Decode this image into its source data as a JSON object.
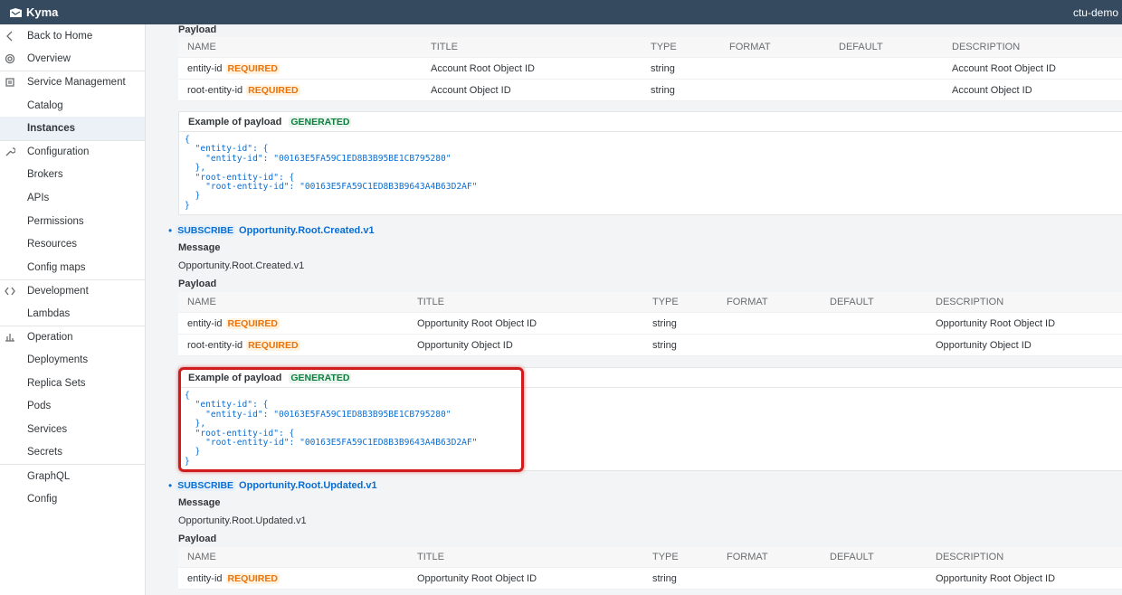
{
  "header": {
    "brand": "Kyma",
    "user": "ctu-demo"
  },
  "sidebar": {
    "items": [
      {
        "label": "Back to Home",
        "icon": "chevron-left-icon",
        "section": true
      },
      {
        "label": "Overview",
        "icon": "gear-icon",
        "section": false
      },
      {
        "label": "Service Management",
        "icon": "service-icon",
        "section": true
      },
      {
        "label": "Catalog",
        "icon": "",
        "section": false
      },
      {
        "label": "Instances",
        "icon": "",
        "section": false,
        "active": true
      },
      {
        "label": "Configuration",
        "icon": "wrench-icon",
        "section": true
      },
      {
        "label": "Brokers",
        "icon": "",
        "section": false
      },
      {
        "label": "APIs",
        "icon": "",
        "section": false
      },
      {
        "label": "Permissions",
        "icon": "",
        "section": false
      },
      {
        "label": "Resources",
        "icon": "",
        "section": false
      },
      {
        "label": "Config maps",
        "icon": "",
        "section": false
      },
      {
        "label": "Development",
        "icon": "code-icon",
        "section": true
      },
      {
        "label": "Lambdas",
        "icon": "",
        "section": false
      },
      {
        "label": "Operation",
        "icon": "operation-icon",
        "section": true
      },
      {
        "label": "Deployments",
        "icon": "",
        "section": false
      },
      {
        "label": "Replica Sets",
        "icon": "",
        "section": false
      },
      {
        "label": "Pods",
        "icon": "",
        "section": false
      },
      {
        "label": "Services",
        "icon": "",
        "section": false
      },
      {
        "label": "Secrets",
        "icon": "",
        "section": false
      },
      {
        "label": "GraphQL",
        "icon": "",
        "section": true
      },
      {
        "label": "Config",
        "icon": "",
        "section": false
      }
    ]
  },
  "labels": {
    "payload": "Payload",
    "message": "Message",
    "example": "Example of payload",
    "generated": "GENERATED",
    "required": "REQUIRED",
    "subscribe": "SUBSCRIBE"
  },
  "columns": [
    "NAME",
    "TITLE",
    "TYPE",
    "FORMAT",
    "DEFAULT",
    "DESCRIPTION"
  ],
  "section0": {
    "rows": [
      {
        "name": "entity-id",
        "title": "Account Root Object ID",
        "type": "string",
        "format": "",
        "default": "",
        "description": "Account Root Object ID"
      },
      {
        "name": "root-entity-id",
        "title": "Account Object ID",
        "type": "string",
        "format": "",
        "default": "",
        "description": "Account Object ID"
      }
    ],
    "example": "{\n  \"entity-id\": {\n    \"entity-id\": \"00163E5FA59C1ED8B3B95BE1CB795280\"\n  },\n  \"root-entity-id\": {\n    \"root-entity-id\": \"00163E5FA59C1ED8B3B9643A4B63D2AF\"\n  }\n}"
  },
  "section1": {
    "event": "Opportunity.Root.Created.v1",
    "message": "Opportunity.Root.Created.v1",
    "rows": [
      {
        "name": "entity-id",
        "title": "Opportunity Root Object ID",
        "type": "string",
        "format": "",
        "default": "",
        "description": "Opportunity Root Object ID"
      },
      {
        "name": "root-entity-id",
        "title": "Opportunity Object ID",
        "type": "string",
        "format": "",
        "default": "",
        "description": "Opportunity Object ID"
      }
    ],
    "example": "{\n  \"entity-id\": {\n    \"entity-id\": \"00163E5FA59C1ED8B3B95BE1CB795280\"\n  },\n  \"root-entity-id\": {\n    \"root-entity-id\": \"00163E5FA59C1ED8B3B9643A4B63D2AF\"\n  }\n}"
  },
  "section2": {
    "event": "Opportunity.Root.Updated.v1",
    "message": "Opportunity.Root.Updated.v1",
    "rows": [
      {
        "name": "entity-id",
        "title": "Opportunity Root Object ID",
        "type": "string",
        "format": "",
        "default": "",
        "description": "Opportunity Root Object ID"
      }
    ]
  },
  "colors": {
    "header": "#354a5f",
    "link": "#0a6ed1",
    "required": "#e9730c",
    "generated": "#107e3e",
    "highlight": "#d01c1c"
  }
}
